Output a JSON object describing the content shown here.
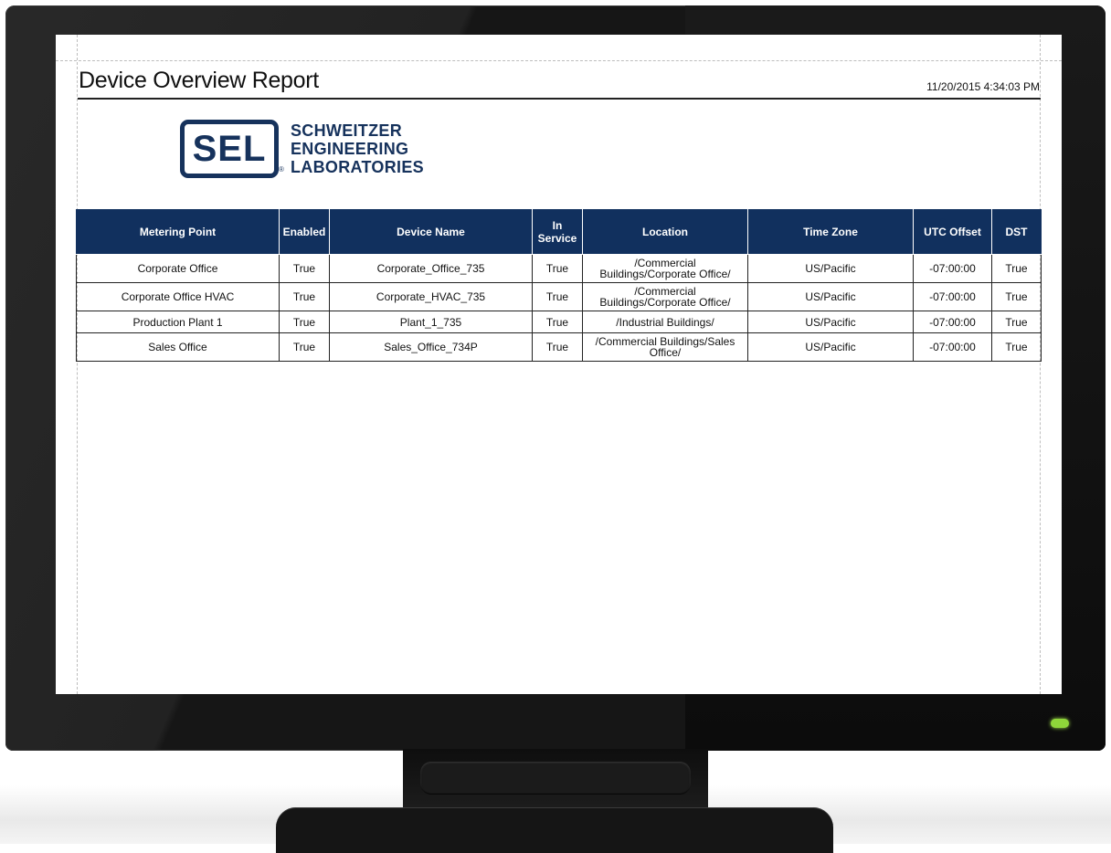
{
  "report": {
    "title": "Device Overview Report",
    "timestamp": "11/20/2015 4:34:03 PM"
  },
  "logo": {
    "mark": "SEL",
    "lines": [
      "SCHWEITZER",
      "ENGINEERING",
      "LABORATORIES"
    ],
    "registered": "®",
    "brand_color": "#16325c"
  },
  "table": {
    "header_color": "#11305e",
    "columns": [
      "Metering Point",
      "Enabled",
      "Device Name",
      "In Service",
      "Location",
      "Time Zone",
      "UTC Offset",
      "DST"
    ],
    "rows": [
      [
        "Corporate Office",
        "True",
        "Corporate_Office_735",
        "True",
        "/Commercial Buildings/Corporate Office/",
        "US/Pacific",
        "-07:00:00",
        "True"
      ],
      [
        "Corporate Office HVAC",
        "True",
        "Corporate_HVAC_735",
        "True",
        "/Commercial Buildings/Corporate Office/",
        "US/Pacific",
        "-07:00:00",
        "True"
      ],
      [
        "Production Plant 1",
        "True",
        "Plant_1_735",
        "True",
        "/Industrial Buildings/",
        "US/Pacific",
        "-07:00:00",
        "True"
      ],
      [
        "Sales Office",
        "True",
        "Sales_Office_734P",
        "True",
        "/Commercial Buildings/Sales Office/",
        "US/Pacific",
        "-07:00:00",
        "True"
      ]
    ]
  },
  "monitor": {
    "power_led_color": "#8fd63a"
  }
}
